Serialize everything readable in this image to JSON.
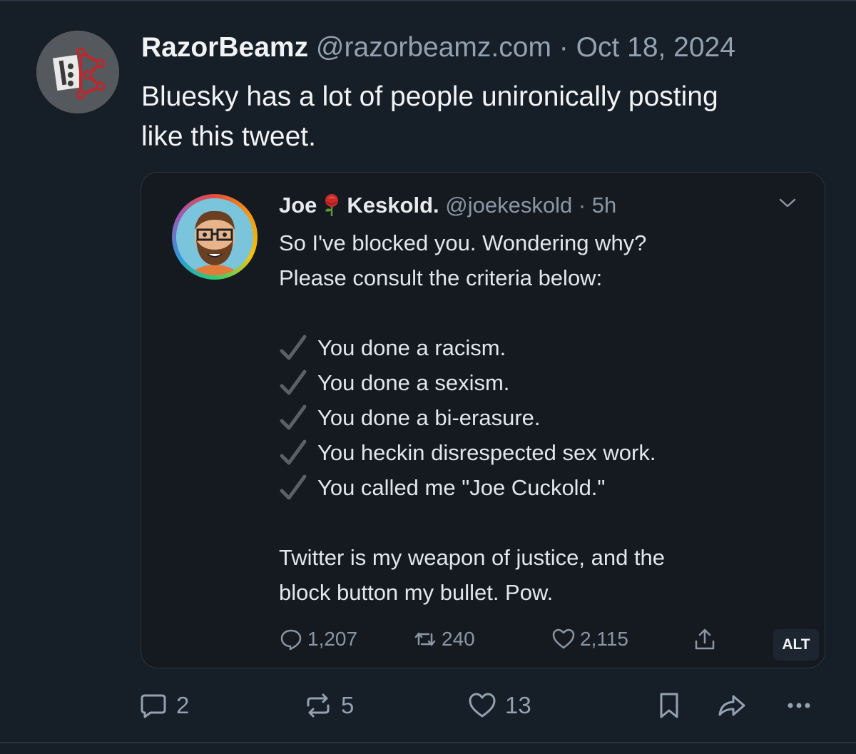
{
  "post": {
    "author_name": "RazorBeamz",
    "author_handle": "@razorbeamz.com",
    "separator": "·",
    "date": "Oct 18, 2024",
    "text_lines": [
      "Bluesky has a lot of people unironically posting",
      "like this tweet."
    ]
  },
  "embed": {
    "name_first": "Joe",
    "name_last": "Keskold.",
    "handle_time": "@joekeskold · 5h",
    "intro_lines": [
      "So I've blocked you. Wondering why?",
      "Please consult the criteria below:"
    ],
    "criteria": [
      "You done a racism.",
      "You done a sexism.",
      "You done a bi-erasure.",
      "You heckin disrespected sex work.",
      "You called me \"Joe Cuckold.\""
    ],
    "closing_lines": [
      "Twitter is my weapon of justice, and the",
      "block button my bullet. Pow."
    ],
    "stats": {
      "replies": "1,207",
      "retweets": "240",
      "likes": "2,115"
    },
    "alt_label": "ALT"
  },
  "actions": {
    "replies": "2",
    "reposts": "5",
    "likes": "13"
  },
  "colors": {
    "background": "#161e27",
    "muted": "#93a1b0",
    "text": "#f1f3f5"
  }
}
